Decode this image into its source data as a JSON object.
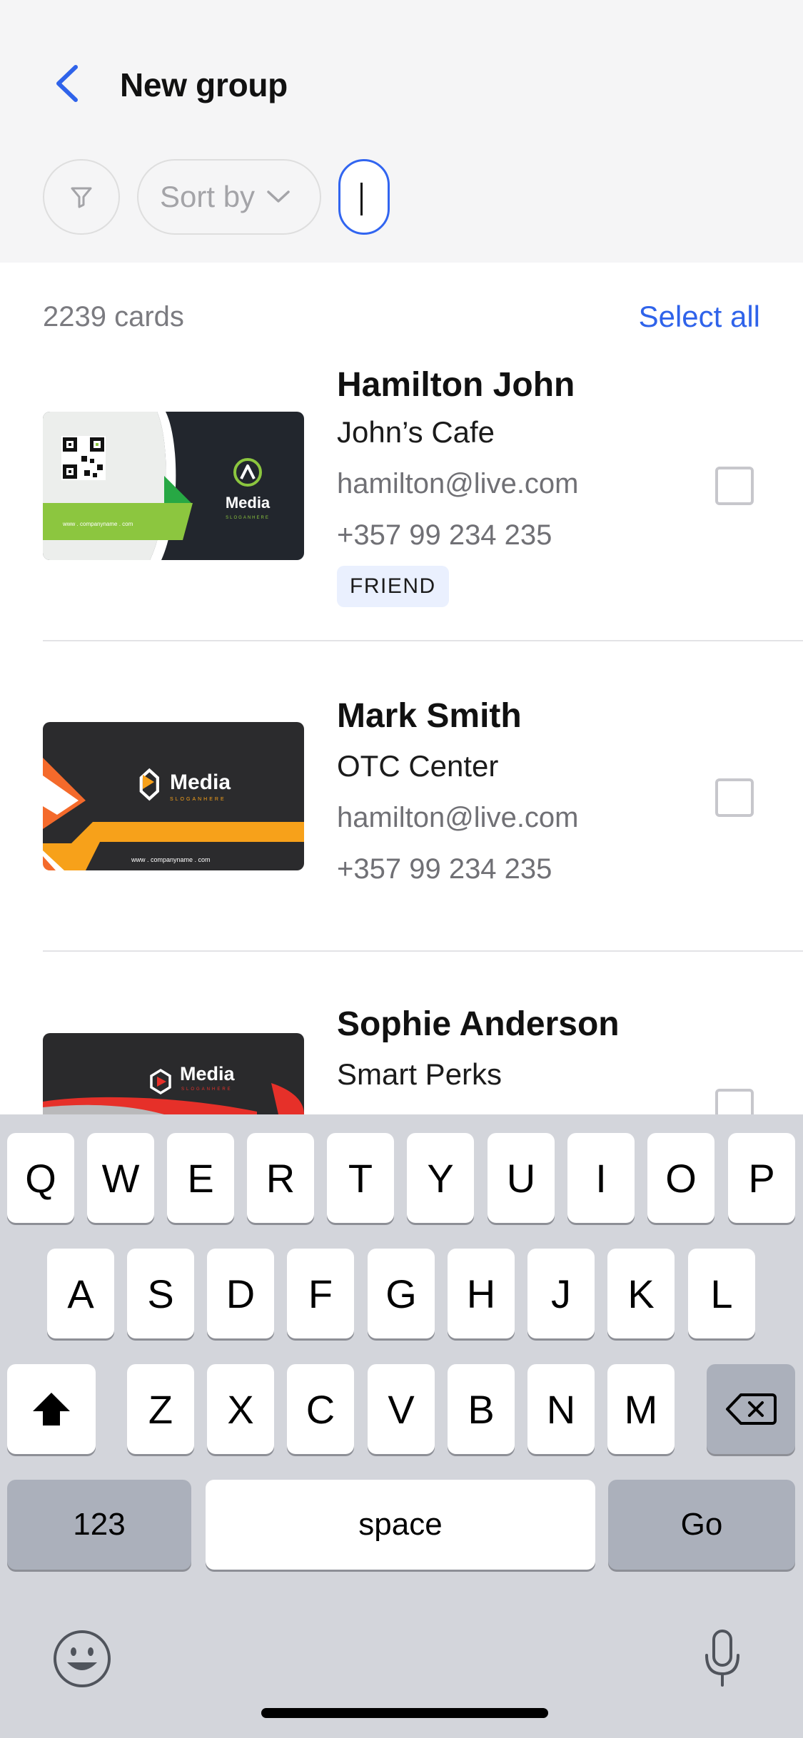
{
  "header": {
    "title": "New group",
    "sort_label": "Sort by",
    "search_value": ""
  },
  "list": {
    "count_label": "2239 cards",
    "select_all_label": "Select all"
  },
  "contacts": [
    {
      "name": "Hamilton John",
      "company": "John’s Cafe",
      "email": "hamilton@live.com",
      "phone": "+357 99 234 235",
      "tag": "FRIEND",
      "card": {
        "brand": "Media",
        "slogan": "SLOGANHERE",
        "website": "www . companyname . com",
        "accent": "#8cc63f"
      }
    },
    {
      "name": "Mark Smith",
      "company": "OTC Center",
      "email": "hamilton@live.com",
      "phone": "+357 99 234 235",
      "card": {
        "brand": "Media",
        "slogan": "SLOGANHERE",
        "website": "www . companyname . com",
        "accent": "#f7a11a"
      }
    },
    {
      "name": "Sophie Anderson",
      "company": "Smart Perks",
      "card": {
        "brand": "Media",
        "slogan": "SLOGANHERE",
        "accent": "#e63029"
      }
    }
  ],
  "keyboard": {
    "row1": [
      "Q",
      "W",
      "E",
      "R",
      "T",
      "Y",
      "U",
      "I",
      "O",
      "P"
    ],
    "row2": [
      "A",
      "S",
      "D",
      "F",
      "G",
      "H",
      "J",
      "K",
      "L"
    ],
    "row3": [
      "Z",
      "X",
      "C",
      "V",
      "B",
      "N",
      "M"
    ],
    "numbers_label": "123",
    "space_label": "space",
    "go_label": "Go"
  },
  "colors": {
    "accent": "#2f63ea",
    "header_bg": "#f5f5f6",
    "keyboard_bg": "#d3d5db"
  },
  "icons": {
    "back": "chevron-left-icon",
    "filter": "filter-icon",
    "sort": "chevron-down-icon",
    "shift": "shift-icon",
    "delete": "backspace-icon",
    "emoji": "emoji-icon",
    "mic": "microphone-icon"
  }
}
